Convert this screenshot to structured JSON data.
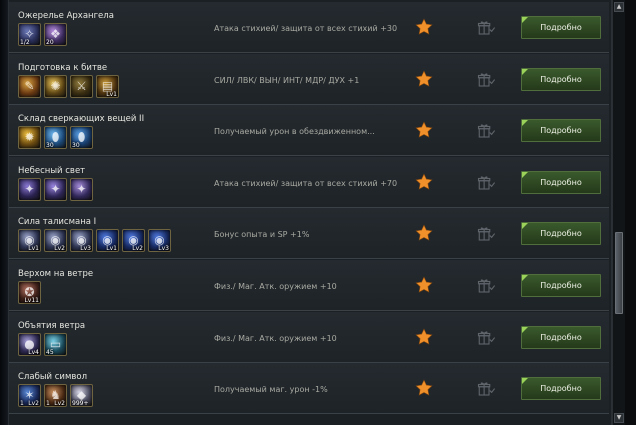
{
  "rows": [
    {
      "name": "Ожерелье Архангела",
      "effect": "Атака стихией/ защита от всех стихий +30",
      "details_label": "Подробно",
      "items": [
        {
          "icon": "necklace-icon",
          "c1": "#6d7ab8",
          "c2": "#2a2f5a",
          "glyph": "✧",
          "qty": "1/2",
          "badge": ""
        },
        {
          "icon": "gem-cluster-icon",
          "c1": "#b98fe0",
          "c2": "#3a2a5c",
          "glyph": "❖",
          "qty": "20",
          "badge": ""
        }
      ]
    },
    {
      "name": "Подготовка к битве",
      "effect": "СИЛ/ ЛВК/ ВЫН/ ИНТ/ МДР/ ДУХ +1",
      "details_label": "Подробно",
      "items": [
        {
          "icon": "scroll-icon",
          "c1": "#d9a441",
          "c2": "#6b3a12",
          "glyph": "✎",
          "qty": "",
          "badge": ""
        },
        {
          "icon": "medal-icon",
          "c1": "#e6c25a",
          "c2": "#5c4414",
          "glyph": "✺",
          "qty": "",
          "badge": ""
        },
        {
          "icon": "armor-icon",
          "c1": "#8f7a3c",
          "c2": "#3a2e12",
          "glyph": "⚔",
          "qty": "",
          "badge": ""
        },
        {
          "icon": "book-icon",
          "c1": "#c89a3a",
          "c2": "#4e3410",
          "glyph": "▤",
          "qty": "",
          "badge": "Lv1"
        }
      ]
    },
    {
      "name": "Склад сверкающих вещей II",
      "effect": "Получаемый урон в обездвиженном...",
      "details_label": "Подробно",
      "items": [
        {
          "icon": "sun-medal-icon",
          "c1": "#f0c040",
          "c2": "#6a4a10",
          "glyph": "✹",
          "qty": "",
          "badge": ""
        },
        {
          "icon": "blue-egg-icon",
          "c1": "#6fb8f0",
          "c2": "#1c4a7a",
          "glyph": "⬮",
          "qty": "30",
          "badge": ""
        },
        {
          "icon": "blue-egg-icon",
          "c1": "#5aa0e6",
          "c2": "#183e6e",
          "glyph": "⬮",
          "qty": "30",
          "badge": ""
        }
      ]
    },
    {
      "name": "Небесный свет",
      "effect": "Атака стихией/ защита от всех стихий +70",
      "details_label": "Подробно",
      "items": [
        {
          "icon": "crystal-icon",
          "c1": "#8c7ad6",
          "c2": "#2a2250",
          "glyph": "✦",
          "qty": "",
          "badge": ""
        },
        {
          "icon": "crystal-icon",
          "c1": "#9a86e0",
          "c2": "#2e2656",
          "glyph": "✦",
          "qty": "",
          "badge": ""
        },
        {
          "icon": "crystal-icon",
          "c1": "#a48cd8",
          "c2": "#32285a",
          "glyph": "✦",
          "qty": "",
          "badge": ""
        }
      ]
    },
    {
      "name": "Сила талисмана I",
      "effect": "Бонус опыта и SP +1%",
      "details_label": "Подробно",
      "items": [
        {
          "icon": "talisman-icon",
          "c1": "#9aa4c8",
          "c2": "#2c3350",
          "glyph": "◉",
          "qty": "",
          "badge": "Lv1"
        },
        {
          "icon": "talisman-icon",
          "c1": "#9aa4c8",
          "c2": "#2c3350",
          "glyph": "◉",
          "qty": "",
          "badge": "Lv2"
        },
        {
          "icon": "talisman-icon",
          "c1": "#9aa4c8",
          "c2": "#2c3350",
          "glyph": "◉",
          "qty": "",
          "badge": "Lv3"
        },
        {
          "icon": "blue-talisman-icon",
          "c1": "#4f7ae0",
          "c2": "#16285e",
          "glyph": "◉",
          "qty": "",
          "badge": "Lv1"
        },
        {
          "icon": "blue-talisman-icon",
          "c1": "#4f7ae0",
          "c2": "#16285e",
          "glyph": "◉",
          "qty": "",
          "badge": "Lv2"
        },
        {
          "icon": "blue-talisman-icon",
          "c1": "#4f7ae0",
          "c2": "#16285e",
          "glyph": "◉",
          "qty": "",
          "badge": "Lv3"
        }
      ]
    },
    {
      "name": "Верхом на ветре",
      "effect": "Физ./ Маг. Атк. оружием +10",
      "details_label": "Подробно",
      "items": [
        {
          "icon": "rune-icon",
          "c1": "#b07060",
          "c2": "#3e2018",
          "glyph": "✪",
          "qty": "",
          "badge": "Lv11"
        }
      ]
    },
    {
      "name": "Объятия ветра",
      "effect": "Физ./ Маг. Атк. оружием +10",
      "details_label": "Подробно",
      "items": [
        {
          "icon": "orb-icon",
          "c1": "#a8a0d8",
          "c2": "#2c2850",
          "glyph": "●",
          "qty": "",
          "badge": "Lv4"
        },
        {
          "icon": "box-icon",
          "c1": "#7ad0e6",
          "c2": "#1a4a5a",
          "glyph": "▭",
          "qty": "45",
          "badge": ""
        }
      ]
    },
    {
      "name": "Слабый символ",
      "effect": "Получаемый маг. урон -1%",
      "details_label": "Подробно",
      "items": [
        {
          "icon": "sigil-icon",
          "c1": "#5a8ad8",
          "c2": "#1a2a5a",
          "glyph": "✶",
          "qty": "1",
          "badge": "Lv2"
        },
        {
          "icon": "warrior-icon",
          "c1": "#c89060",
          "c2": "#4a2a14",
          "glyph": "♞",
          "qty": "1",
          "badge": "Lv2"
        },
        {
          "icon": "shard-icon",
          "c1": "#d8d8e8",
          "c2": "#4a4a5e",
          "glyph": "◆",
          "qty": "999+",
          "badge": ""
        }
      ]
    }
  ],
  "colors": {
    "accent": "#f0902a",
    "button": "#2f4a22",
    "text": "#e6e6e0",
    "muted": "#a9aaa2"
  }
}
